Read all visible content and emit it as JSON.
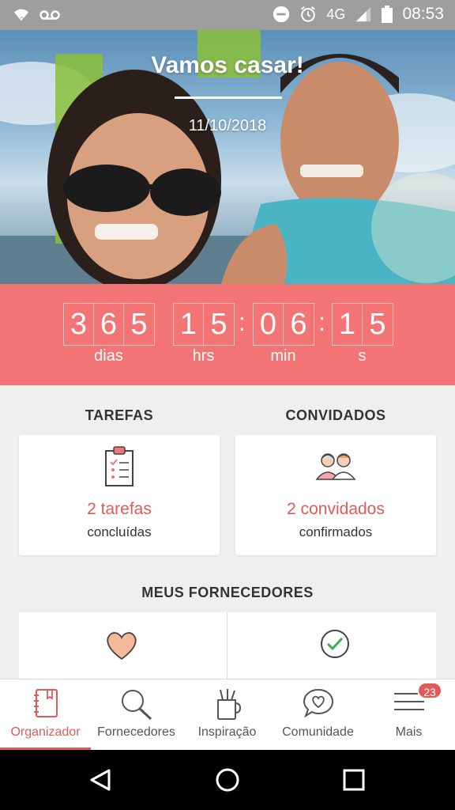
{
  "status_bar": {
    "network": "4G",
    "time": "08:53",
    "icons": [
      "wifi-icon",
      "voicemail-icon",
      "dnd-icon",
      "alarm-icon",
      "signal-icon",
      "battery-icon"
    ]
  },
  "hero": {
    "title": "Vamos casar!",
    "date": "11/10/2018"
  },
  "countdown": {
    "days": [
      "3",
      "6",
      "5"
    ],
    "hours": [
      "1",
      "5"
    ],
    "minutes": [
      "0",
      "6"
    ],
    "seconds": [
      "1",
      "5"
    ],
    "labels": {
      "days": "dias",
      "hours": "hrs",
      "minutes": "min",
      "seconds": "s"
    }
  },
  "tasks": {
    "title": "TAREFAS",
    "count": "2 tarefas",
    "sub": "concluídas",
    "icon": "clipboard-icon"
  },
  "guests": {
    "title": "CONVIDADOS",
    "count": "2 convidados",
    "sub": "confirmados",
    "icon": "guests-icon"
  },
  "suppliers": {
    "title": "MEUS FORNECEDORES",
    "icons": [
      "heart-icon",
      "check-circle-icon"
    ]
  },
  "bottom_nav": {
    "items": [
      {
        "label": "Organizador",
        "icon": "notebook-icon",
        "active": true
      },
      {
        "label": "Fornecedores",
        "icon": "search-icon",
        "active": false
      },
      {
        "label": "Inspiração",
        "icon": "brushes-icon",
        "active": false
      },
      {
        "label": "Comunidade",
        "icon": "chat-heart-icon",
        "active": false
      },
      {
        "label": "Mais",
        "icon": "menu-icon",
        "active": false
      }
    ],
    "badge": "23"
  },
  "colors": {
    "accent": "#f27474",
    "accent_text": "#e05a5a",
    "status_bar": "#9e9e9e"
  }
}
